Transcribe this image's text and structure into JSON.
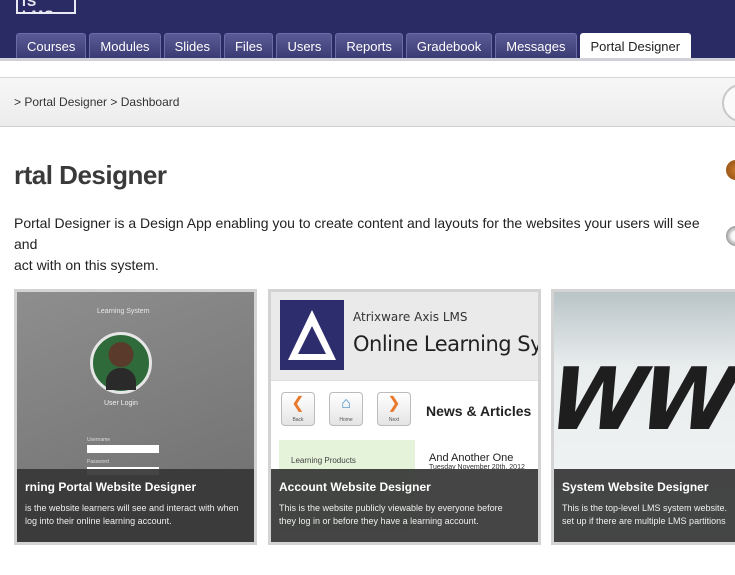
{
  "app": {
    "logo_text": "IS LMS"
  },
  "nav": {
    "tabs": [
      {
        "label": "Courses"
      },
      {
        "label": "Modules"
      },
      {
        "label": "Slides"
      },
      {
        "label": "Files"
      },
      {
        "label": "Users"
      },
      {
        "label": "Reports"
      },
      {
        "label": "Gradebook"
      },
      {
        "label": "Messages"
      },
      {
        "label": "Portal Designer",
        "active": true
      }
    ]
  },
  "breadcrumb": {
    "text": "> Portal Designer > Dashboard"
  },
  "page": {
    "title": "rtal Designer",
    "intro_line1": "Portal Designer is a Design App enabling you to create content and layouts for the websites your users will see and",
    "intro_line2": "act with on this system."
  },
  "cards": [
    {
      "title": "rning Portal Website Designer",
      "desc_line1": "is the website learners will see and interact with when",
      "desc_line2": "log into their online learning account.",
      "mock": {
        "header": "Learning System",
        "login": "User Login",
        "field1": "Username",
        "field2": "Password"
      }
    },
    {
      "title": "Account Website Designer",
      "desc_line1": "This is the website publicly viewable by everyone before",
      "desc_line2": "they log in or before they have a learning account.",
      "mock": {
        "brand": "Atrixware Axis LMS",
        "system": "Online Learning System",
        "back": "Back",
        "home": "Home",
        "next": "Next",
        "news": "News & Articles",
        "left": "Learning Products",
        "article": "And Another One",
        "date": "Tuesday November 20th, 2012"
      }
    },
    {
      "title": "System Website Designer",
      "desc_line1": "This is the top-level LMS system website.",
      "desc_line2": "set up if there are multiple LMS partitions",
      "mock": {
        "graphic": "WWW"
      }
    }
  ],
  "colors": {
    "nav_bg": "#2a2a64",
    "tab_bg": "#4b4b86",
    "caption_bg": "#373737"
  }
}
